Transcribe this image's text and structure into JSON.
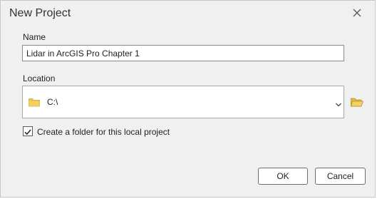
{
  "dialog": {
    "title": "New Project",
    "close_icon": "close-icon"
  },
  "name_field": {
    "label": "Name",
    "value": "Lidar in ArcGIS Pro Chapter 1"
  },
  "location_field": {
    "label": "Location",
    "value": "C:\\",
    "folder_icon": "folder-icon",
    "dropdown_icon": "chevron-down-icon",
    "browse_icon": "folder-open-icon"
  },
  "create_folder": {
    "label": "Create a folder for this local project",
    "checked": true
  },
  "buttons": {
    "ok_label": "OK",
    "cancel_label": "Cancel"
  },
  "colors": {
    "dialog_background": "#f0f0f0",
    "folder_yellow": "#e8c14e",
    "border": "#8a8a8a"
  }
}
